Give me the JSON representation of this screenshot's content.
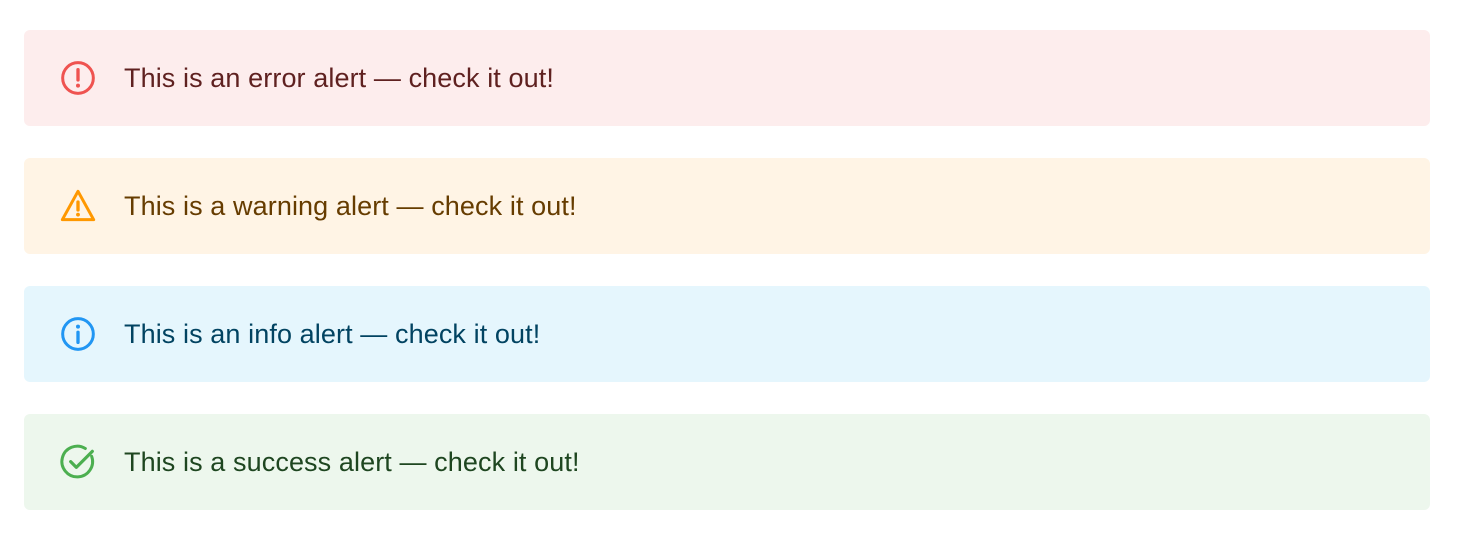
{
  "alerts": [
    {
      "severity": "error",
      "icon": "error-outline-icon",
      "message": "This is an error alert — check it out!",
      "background": "#fdeded",
      "icon_color": "#ef5350",
      "text_color": "#5f2120"
    },
    {
      "severity": "warning",
      "icon": "warning-outline-icon",
      "message": "This is a warning alert — check it out!",
      "background": "#fff4e5",
      "icon_color": "#ff9800",
      "text_color": "#663c00"
    },
    {
      "severity": "info",
      "icon": "info-outline-icon",
      "message": "This is an info alert — check it out!",
      "background": "#e5f6fd",
      "icon_color": "#2196f3",
      "text_color": "#014361"
    },
    {
      "severity": "success",
      "icon": "success-outline-icon",
      "message": "This is a success alert — check it out!",
      "background": "#edf7ed",
      "icon_color": "#4caf50",
      "text_color": "#1e4620"
    }
  ]
}
